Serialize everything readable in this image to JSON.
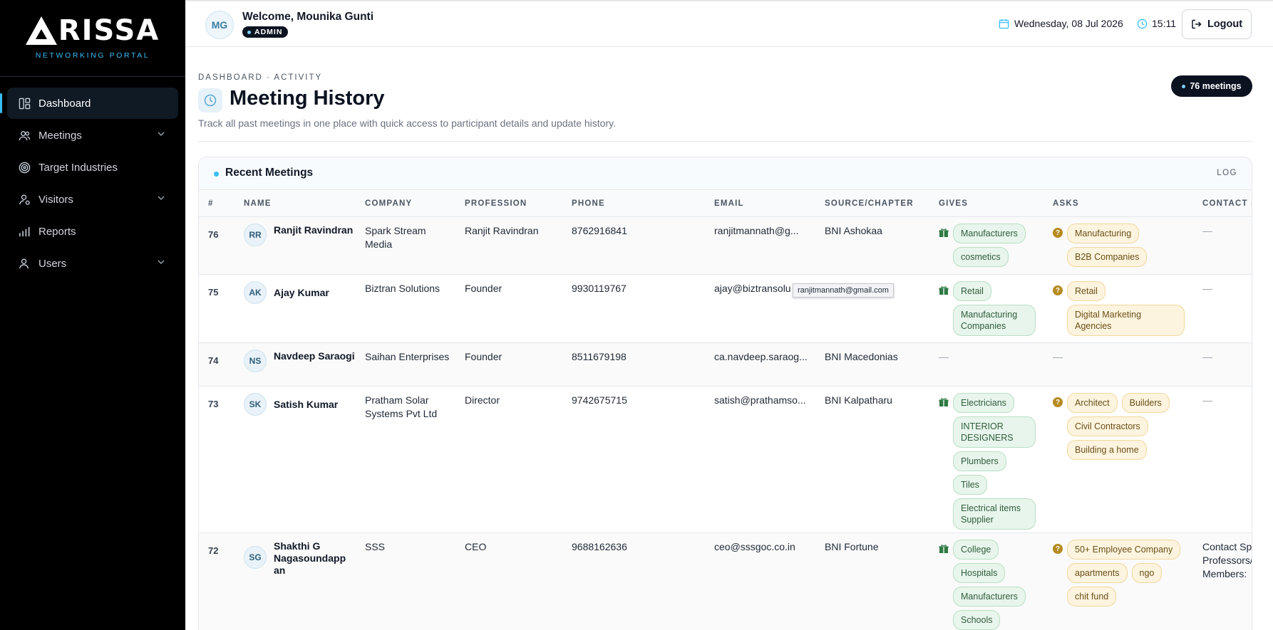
{
  "brand": {
    "name": "ARISSA",
    "tagline": "NETWORKING PORTAL"
  },
  "sidebar": {
    "items": [
      {
        "label": "Dashboard",
        "icon": "dashboard-icon",
        "active": true
      },
      {
        "label": "Meetings",
        "icon": "users-icon",
        "expandable": true
      },
      {
        "label": "Target Industries",
        "icon": "target-icon"
      },
      {
        "label": "Visitors",
        "icon": "visitor-icon",
        "expandable": true
      },
      {
        "label": "Reports",
        "icon": "bar-chart-icon"
      },
      {
        "label": "Users",
        "icon": "user-icon",
        "expandable": true
      }
    ]
  },
  "header": {
    "avatar_initials": "MG",
    "welcome": "Welcome, Mounika Gunti",
    "role": "ADMIN",
    "date": "Wednesday, 08 Jul 2026",
    "time": "15:11",
    "logout_label": "Logout"
  },
  "page": {
    "breadcrumb": "DASHBOARD · ACTIVITY",
    "title": "Meeting History",
    "subtitle": "Track all past meetings in one place with quick access to participant details and update history.",
    "count_label": "76 meetings"
  },
  "card": {
    "title": "Recent Meetings",
    "log_label": "LOG",
    "columns": [
      "#",
      "NAME",
      "COMPANY",
      "PROFESSION",
      "PHONE",
      "EMAIL",
      "SOURCE/CHAPTER",
      "GIVES",
      "ASKS",
      "CONTACT S"
    ],
    "tooltip": "ranjitmannath@gmail.com",
    "rows": [
      {
        "num": "76",
        "initials": "RR",
        "name": "Ranjit Ravindran",
        "company": "Spark Stream Media",
        "profession": "Ranjit Ravindran",
        "phone": "8762916841",
        "email": "ranjitmannath@g...",
        "source": "BNI Ashokaa",
        "gives": [
          "Manufacturers",
          "cosmetics"
        ],
        "asks": [
          "Manufacturing",
          "B2B Companies"
        ],
        "contact": "—"
      },
      {
        "num": "75",
        "initials": "AK",
        "name": "Ajay Kumar",
        "company": "Biztran Solutions",
        "profession": "Founder",
        "phone": "9930119767",
        "email": "ajay@biztransolu",
        "source": "",
        "gives": [
          "Retail",
          "Manufacturing Companies"
        ],
        "asks": [
          "Retail",
          "Digital Marketing Agencies"
        ],
        "contact": "—"
      },
      {
        "num": "74",
        "initials": "NS",
        "name": "Navdeep Saraogi",
        "company": "Saihan Enterprises",
        "profession": "Founder",
        "phone": "8511679198",
        "email": "ca.navdeep.saraog...",
        "source": "BNI Macedonias",
        "gives": [],
        "asks": [],
        "gives_empty": "—",
        "asks_empty": "—",
        "contact": "—"
      },
      {
        "num": "73",
        "initials": "SK",
        "name": "Satish Kumar",
        "company": "Pratham Solar Systems Pvt Ltd",
        "profession": "Director",
        "phone": "9742675715",
        "email": "satish@prathamso...",
        "source": "BNI Kalpatharu",
        "gives": [
          "Electricians",
          "INTERIOR DESIGNERS",
          "Plumbers",
          "Tiles",
          "Electrical items Supplier"
        ],
        "asks": [
          "Architect",
          "Builders",
          "Civil Contractors",
          "Building a home"
        ],
        "contact": "—"
      },
      {
        "num": "72",
        "initials": "SG",
        "name": "Shakthi G Nagasoundapp an",
        "company": "SSS",
        "profession": "CEO",
        "phone": "9688162636",
        "email": "ceo@sssgoc.co.in",
        "source": "BNI Fortune",
        "gives": [
          "College",
          "Hospitals",
          "Manufacturers",
          "Schools"
        ],
        "asks": [
          "50+ Employee Company",
          "apartments",
          "ngo",
          "chit fund"
        ],
        "contact": "Contact Sp Professors/ Members:"
      }
    ]
  },
  "colors": {
    "sidebar_bg": "#000000",
    "accent": "#38bdf8",
    "give_bg": "#e8f5ec",
    "ask_bg": "#fdf4df"
  }
}
